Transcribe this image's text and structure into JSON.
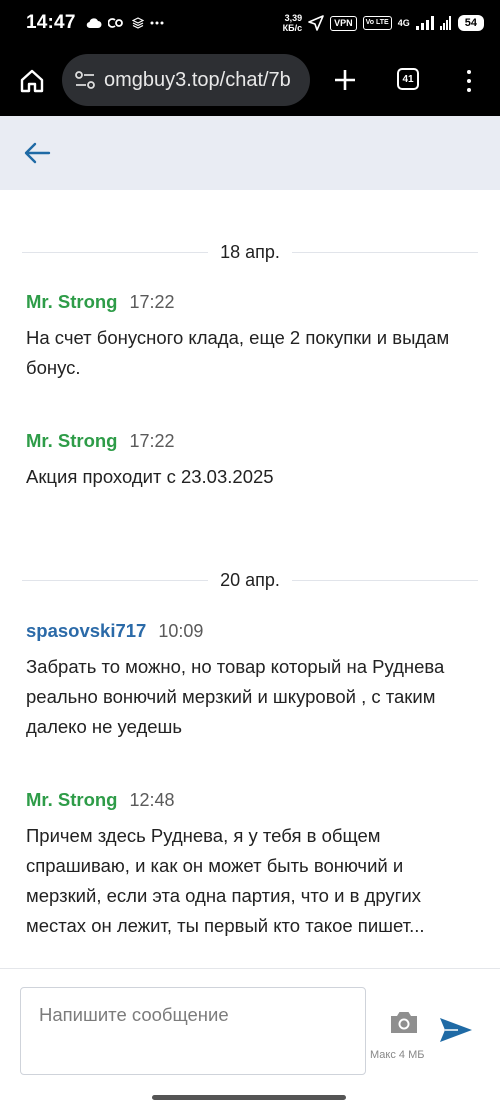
{
  "status_bar": {
    "time": "14:47",
    "left_icons": [
      "cloud-icon",
      "co-logo-icon",
      "layers-icon",
      "more-dots-icon"
    ],
    "speed_value": "3,39",
    "speed_unit": "КБ/с",
    "vpn_label": "VPN",
    "volte_label": "Vo LTE",
    "network_label": "4G",
    "battery": "54"
  },
  "browser": {
    "url": "omgbuy3.top/chat/7b",
    "tab_count": "41"
  },
  "chat": {
    "messages": [
      {
        "type": "date",
        "label": "18 апр."
      },
      {
        "type": "message",
        "author": "Mr. Strong",
        "time": "17:22",
        "color": "#2e9c48",
        "text": "На счет бонусного клада, еще 2 покупки и выдам бонус."
      },
      {
        "type": "message",
        "author": "Mr. Strong",
        "time": "17:22",
        "color": "#2e9c48",
        "text": "Акция проходит с 23.03.2025"
      },
      {
        "type": "date",
        "label": "20 апр."
      },
      {
        "type": "message",
        "author": "spasovski717",
        "time": "10:09",
        "color": "#2b6aa8",
        "text": "Забрать то можно, но товар который на Руднева реально вонючий мерзкий и шкуровой , с таким далеко не уедешь"
      },
      {
        "type": "message",
        "author": "Mr. Strong",
        "time": "12:48",
        "color": "#2e9c48",
        "text": "Причем здесь Руднева, я у тебя в общем спрашиваю, и как он может быть вонючий и мерзкий, если эта одна партия, что и в других местах он лежит, ты первый кто такое пишет..."
      }
    ]
  },
  "composer": {
    "placeholder": "Напишите сообщение",
    "attach_limit": "Макс 4 МБ"
  },
  "colors": {
    "header_bg": "#e9ecf3",
    "accent_blue": "#1f6aa5",
    "author_green": "#2e9c48",
    "author_blue": "#2b6aa8"
  }
}
